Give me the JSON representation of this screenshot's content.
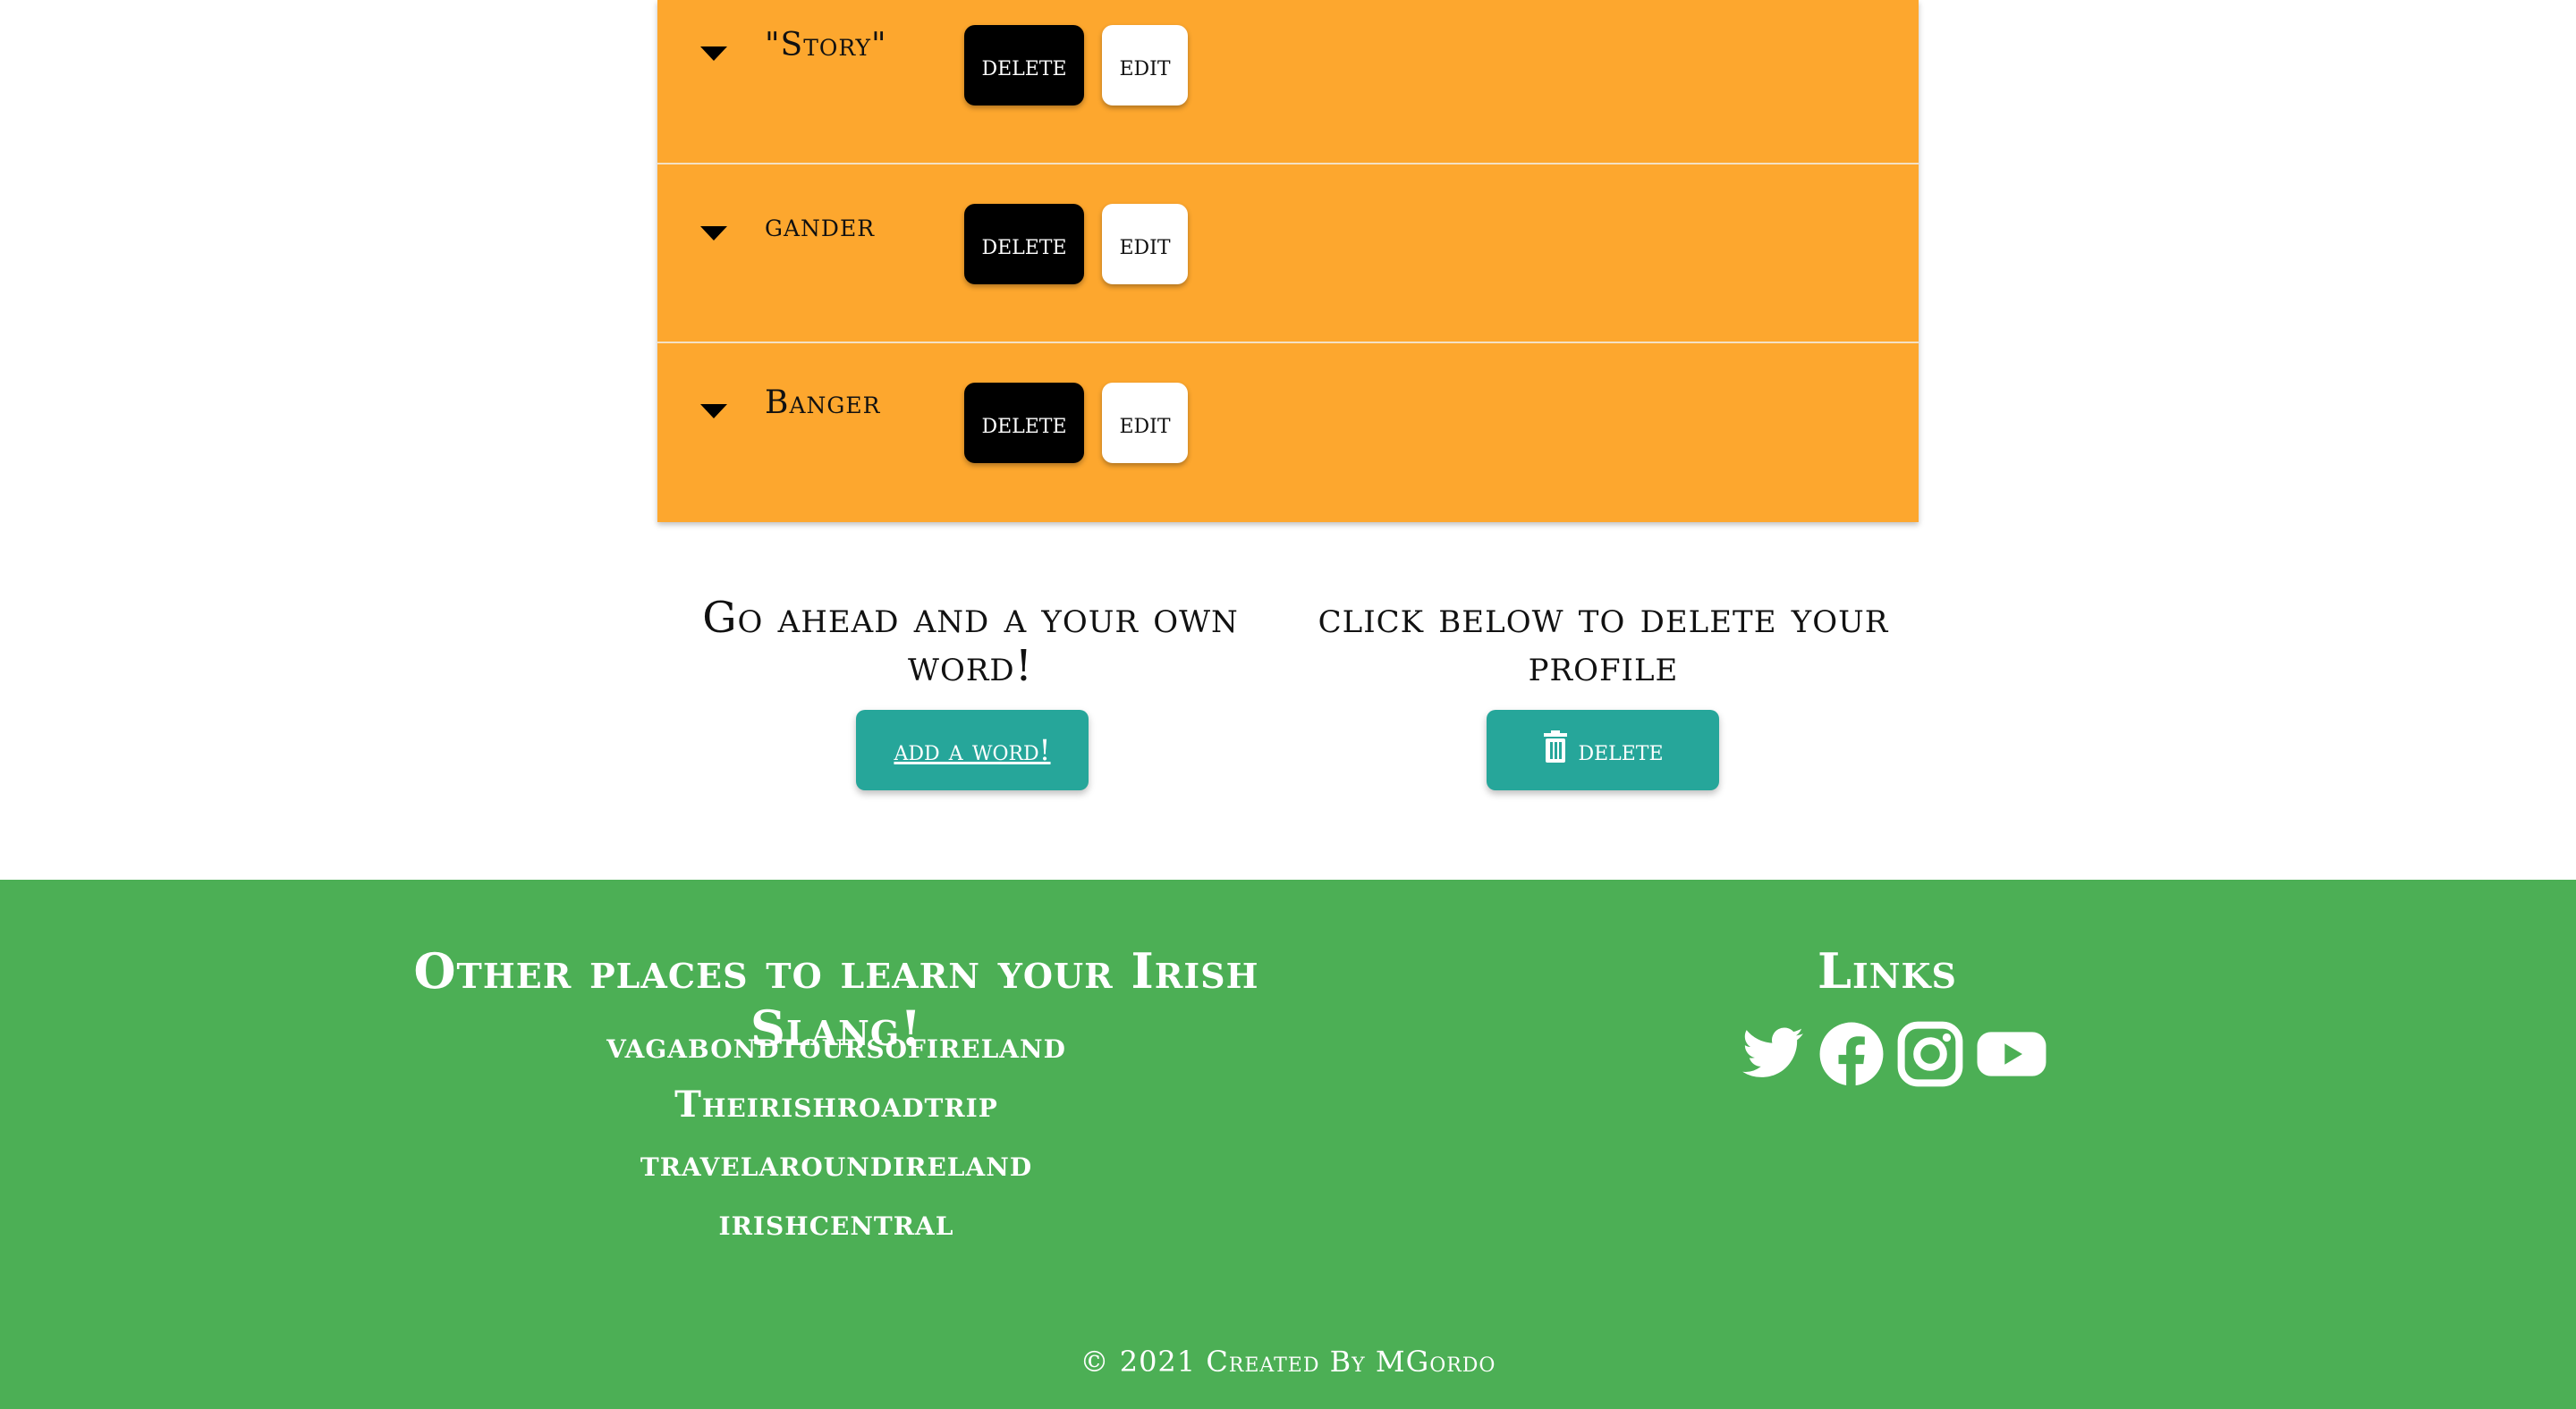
{
  "words": [
    {
      "title": "\"Story\"",
      "delete_label": "delete",
      "edit_label": "edit"
    },
    {
      "title": "gander",
      "delete_label": "delete",
      "edit_label": "edit"
    },
    {
      "title": "Banger",
      "delete_label": "delete",
      "edit_label": "edit"
    }
  ],
  "actions": {
    "add_text": "Go ahead and a your own word!",
    "add_button": "add a word!",
    "delete_text": "click below to delete your profile",
    "delete_button": "delete"
  },
  "footer": {
    "places_heading": "Other places to learn your Irish Slang!",
    "links_heading": "Links",
    "sites": [
      "vagabondtoursofireland",
      "Theirishroadtrip",
      "travelaroundireland",
      "irishcentral"
    ],
    "social_icons": [
      "twitter-icon",
      "facebook-icon",
      "instagram-icon",
      "youtube-icon"
    ],
    "copyright": "© 2021 Created By MGordo"
  },
  "colors": {
    "word_bg": "#fda72e",
    "teal": "#26a69a",
    "footer_bg": "#4caf55"
  }
}
